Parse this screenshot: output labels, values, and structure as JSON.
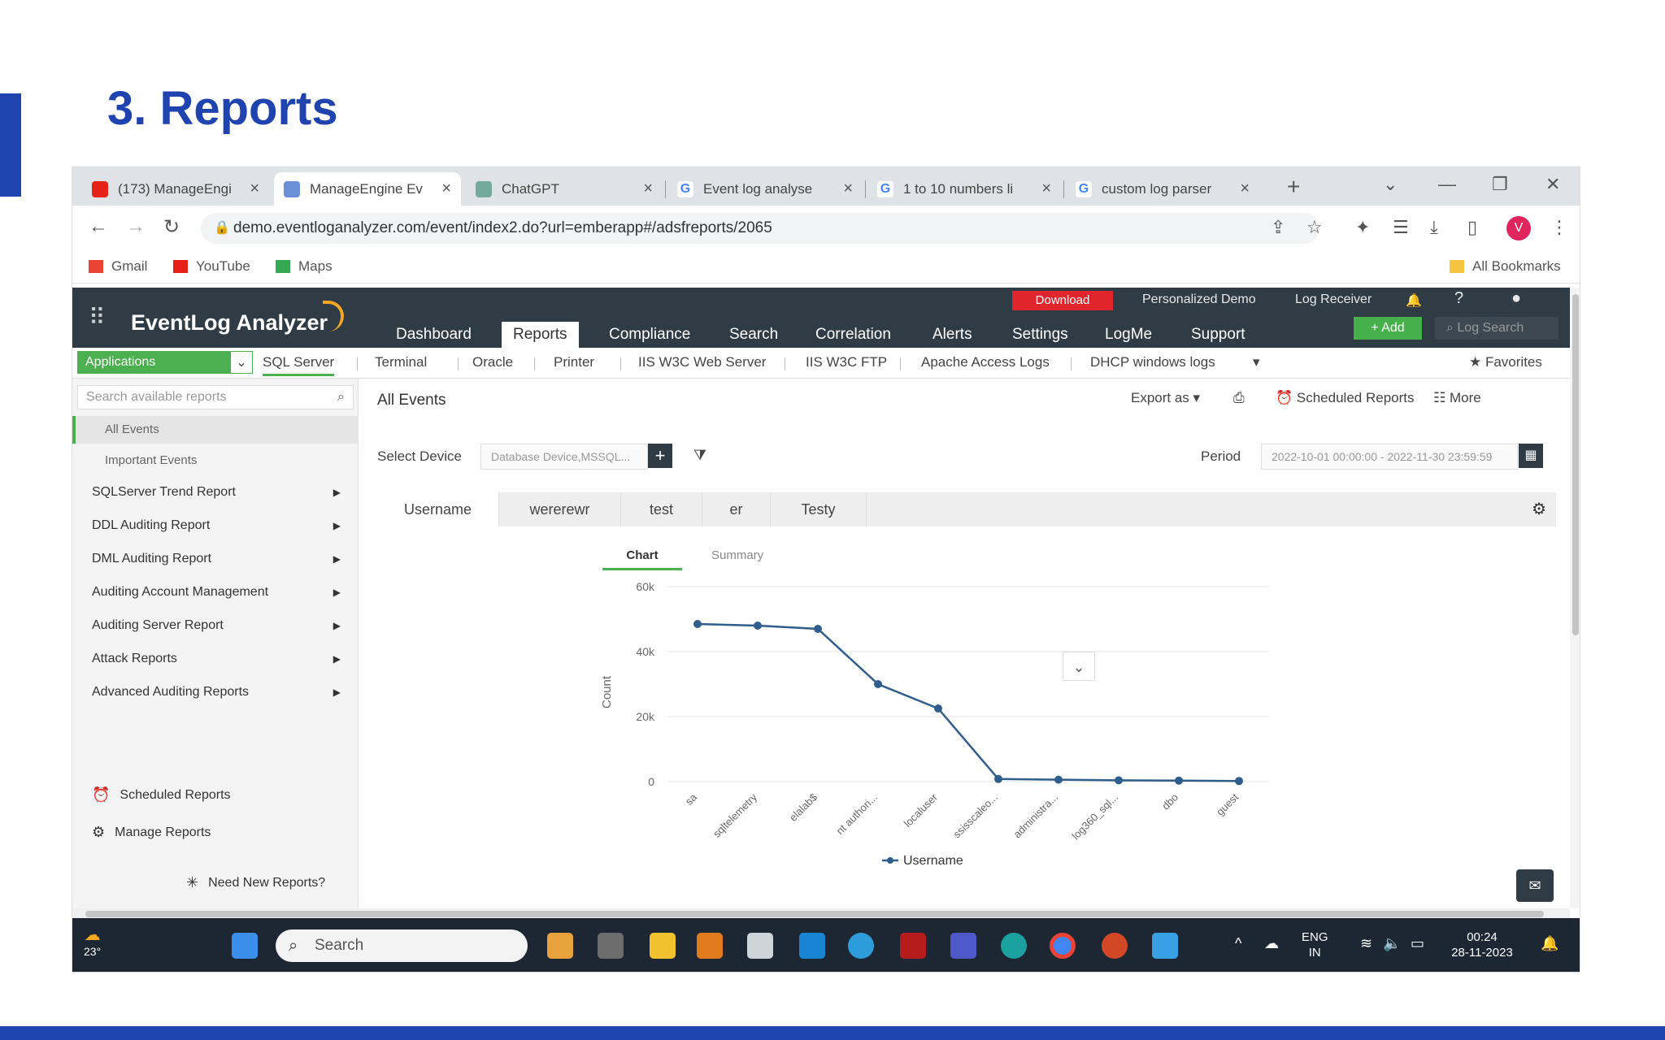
{
  "slide": {
    "title": "3. Reports"
  },
  "browser": {
    "tabs": [
      {
        "label": "(173) ManageEngi",
        "color": "#e62117"
      },
      {
        "label": "ManageEngine Ev",
        "color": "#6b8fd8"
      },
      {
        "label": "ChatGPT",
        "color": "#74aa9c"
      },
      {
        "label": "Event log analyse",
        "color": "#4285f4"
      },
      {
        "label": "1 to 10 numbers li",
        "color": "#4285f4"
      },
      {
        "label": "custom log parser",
        "color": "#4285f4"
      }
    ],
    "url": "demo.eventloganalyzer.com/event/index2.do?url=emberapp#/adsfreports/2065",
    "avatar_letter": "V",
    "bookmarks": [
      {
        "label": "Gmail",
        "color": "#ea4335"
      },
      {
        "label": "YouTube",
        "color": "#e62117"
      },
      {
        "label": "Maps",
        "color": "#34a853"
      }
    ],
    "all_bookmarks": "All Bookmarks"
  },
  "app": {
    "logo": "EventLog Analyzer",
    "top_links": {
      "download": "Download",
      "demo": "Personalized Demo",
      "receiver": "Log Receiver"
    },
    "nav": [
      "Dashboard",
      "Reports",
      "Compliance",
      "Search",
      "Correlation",
      "Alerts",
      "Settings",
      "LogMe",
      "Support"
    ],
    "add_label": "+ Add",
    "log_search": "Log Search",
    "app_select": "Applications",
    "subnav": [
      "SQL Server",
      "Terminal",
      "Oracle",
      "Printer",
      "IIS W3C Web Server",
      "IIS W3C FTP",
      "Apache Access Logs",
      "DHCP windows logs"
    ],
    "favorites": "Favorites",
    "sidebar": {
      "search_placeholder": "Search available reports",
      "sub_items": [
        "All Events",
        "Important Events"
      ],
      "items": [
        "SQLServer Trend Report",
        "DDL Auditing Report",
        "DML Auditing Report",
        "Auditing Account Management",
        "Auditing Server Report",
        "Attack Reports",
        "Advanced Auditing Reports"
      ],
      "scheduled": "Scheduled Reports",
      "manage": "Manage Reports",
      "need_new": "Need New Reports?"
    },
    "content": {
      "title": "All Events",
      "export_as": "Export as",
      "scheduled_reports": "Scheduled Reports",
      "more": "More",
      "select_device_label": "Select Device",
      "device_value": "Database Device,MSSQL...",
      "period_label": "Period",
      "period_value": "2022-10-01 00:00:00 - 2022-11-30 23:59:59",
      "report_tabs": [
        "Username",
        "wererewr",
        "test",
        "er",
        "Testy"
      ],
      "chart_tabs": [
        "Chart",
        "Summary"
      ]
    }
  },
  "chart_data": {
    "type": "line",
    "categories": [
      "sa",
      "sqltelemetry",
      "elalab$",
      "nt authori...",
      "localuser",
      "ssisscaleo...",
      "administra...",
      "log360_sql...",
      "dbo",
      "guest"
    ],
    "series": [
      {
        "name": "Username",
        "values": [
          48500,
          48000,
          47000,
          30000,
          22500,
          800,
          600,
          400,
          300,
          200
        ],
        "color": "#2f5d8c"
      }
    ],
    "ylabel": "Count",
    "yticks": [
      "0",
      "20k",
      "40k",
      "60k"
    ],
    "ylim": [
      0,
      60000
    ],
    "legend": "bottom"
  },
  "taskbar": {
    "weather": "23°",
    "search": "Search",
    "lang": [
      "ENG",
      "IN"
    ],
    "time": "00:24",
    "date": "28-11-2023"
  }
}
